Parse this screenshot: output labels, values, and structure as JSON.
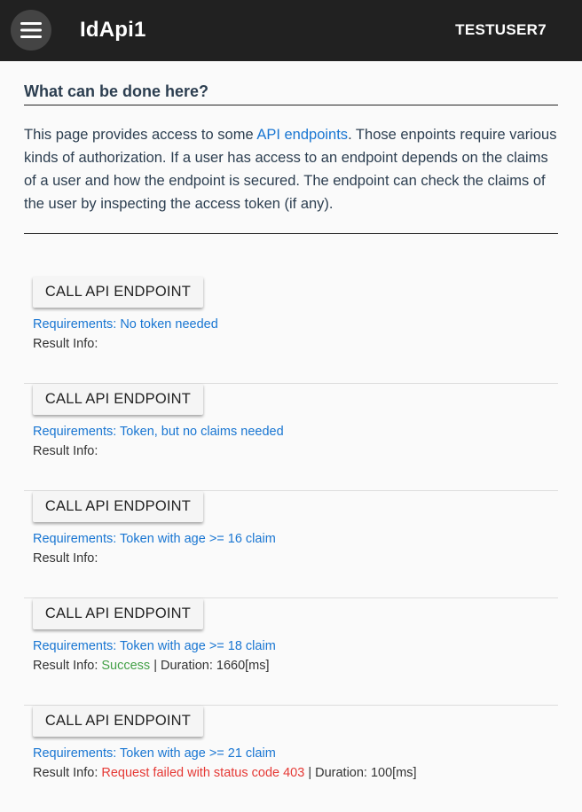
{
  "header": {
    "menu_icon": "hamburger-menu-icon",
    "title": "IdApi1",
    "user": "TESTUSER7"
  },
  "intro": {
    "heading": "What can be done here?",
    "text_before": "This page provides access to some ",
    "link": "API endpoints",
    "text_after": ". Those enpoints require various kinds of authorization. If a user has access to an endpoint depends on the claims of a user and how the endpoint is secured. The endpoint can check the claims of the user by inspecting the access token (if any)."
  },
  "calls": [
    {
      "button": "CALL API ENDPOINT",
      "requirements": "Requirements: No token needed",
      "result_label": "Result Info:",
      "status": "",
      "duration": ""
    },
    {
      "button": "CALL API ENDPOINT",
      "requirements": "Requirements: Token, but no claims needed",
      "result_label": "Result Info:",
      "status": "",
      "duration": ""
    },
    {
      "button": "CALL API ENDPOINT",
      "requirements": "Requirements: Token with age >= 16 claim",
      "result_label": "Result Info:",
      "status": "",
      "duration": ""
    },
    {
      "button": "CALL API ENDPOINT",
      "requirements": "Requirements: Token with age >= 18 claim",
      "result_label": "Result Info:",
      "status": "Success",
      "duration": " | Duration: 1660[ms]"
    },
    {
      "button": "CALL API ENDPOINT",
      "requirements": "Requirements: Token with age >= 21 claim",
      "result_label": "Result Info:",
      "status": "Request failed with status code 403",
      "duration": " | Duration: 100[ms]"
    }
  ],
  "colors": {
    "topbar": "#212121",
    "link": "#1976d2",
    "success": "#43a047",
    "error": "#e53935"
  }
}
